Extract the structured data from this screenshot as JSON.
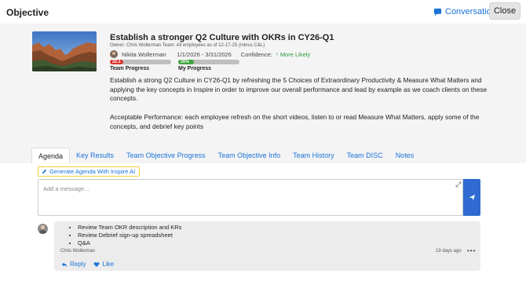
{
  "window": {
    "title": "Objective"
  },
  "header": {
    "conversation_label": "Conversation",
    "close_label": "Close"
  },
  "objective": {
    "title": "Establish a stronger Q2 Culture with OKRs in CY26-Q1",
    "owner_line": "Owner: Chris Wollerman Team: All employees as of 12-17-25 (minus C&L)",
    "person": "Nikita Wollerman",
    "date_range": "1/1/2026 - 3/31/2026",
    "confidence_label": "Confidence:",
    "confidence_value": "More Likely",
    "confidence_color": "#2e9a3e",
    "team_progress": {
      "value": 22.1,
      "display": "22.1",
      "label": "Team Progress",
      "color": "#d9342b"
    },
    "my_progress": {
      "value": 26,
      "display": "26%",
      "label": "My Progress",
      "color": "#3da63d"
    },
    "description": [
      "Establish a strong Q2 Culture in CY26-Q1 by refreshing the 5 Choices of Extraordinary Productivity & Measure What Matters and applying the key concepts in Inspire in order to improve our overall performance and lead by example as we coach clients on these concepts.",
      "Acceptable Performance: each employee refresh on the short videos, listen to or read Measure What Matters, apply some of the concepts, and debrief key points"
    ]
  },
  "tabs": [
    {
      "label": "Agenda",
      "active": true
    },
    {
      "label": "Key Results",
      "active": false
    },
    {
      "label": "Team Objective Progress",
      "active": false
    },
    {
      "label": "Team Objective Info",
      "active": false
    },
    {
      "label": "Team History",
      "active": false
    },
    {
      "label": "Team DISC",
      "active": false
    },
    {
      "label": "Notes",
      "active": false
    }
  ],
  "agenda": {
    "generate_label": "Generate Agenda With Inspire AI",
    "message_placeholder": "Add a message...",
    "comment": {
      "items": [
        "Review Team OKR description and KRs",
        "Review Debrief sign-up spreadsheet",
        "Q&A"
      ],
      "author": "Chris Wollerman",
      "time": "19 days ago",
      "more": "•••",
      "reply_label": "Reply",
      "like_label": "Like"
    }
  },
  "colors": {
    "accent": "#1a73d9",
    "send": "#2f6bd0",
    "highlight": "#f0d23a"
  }
}
